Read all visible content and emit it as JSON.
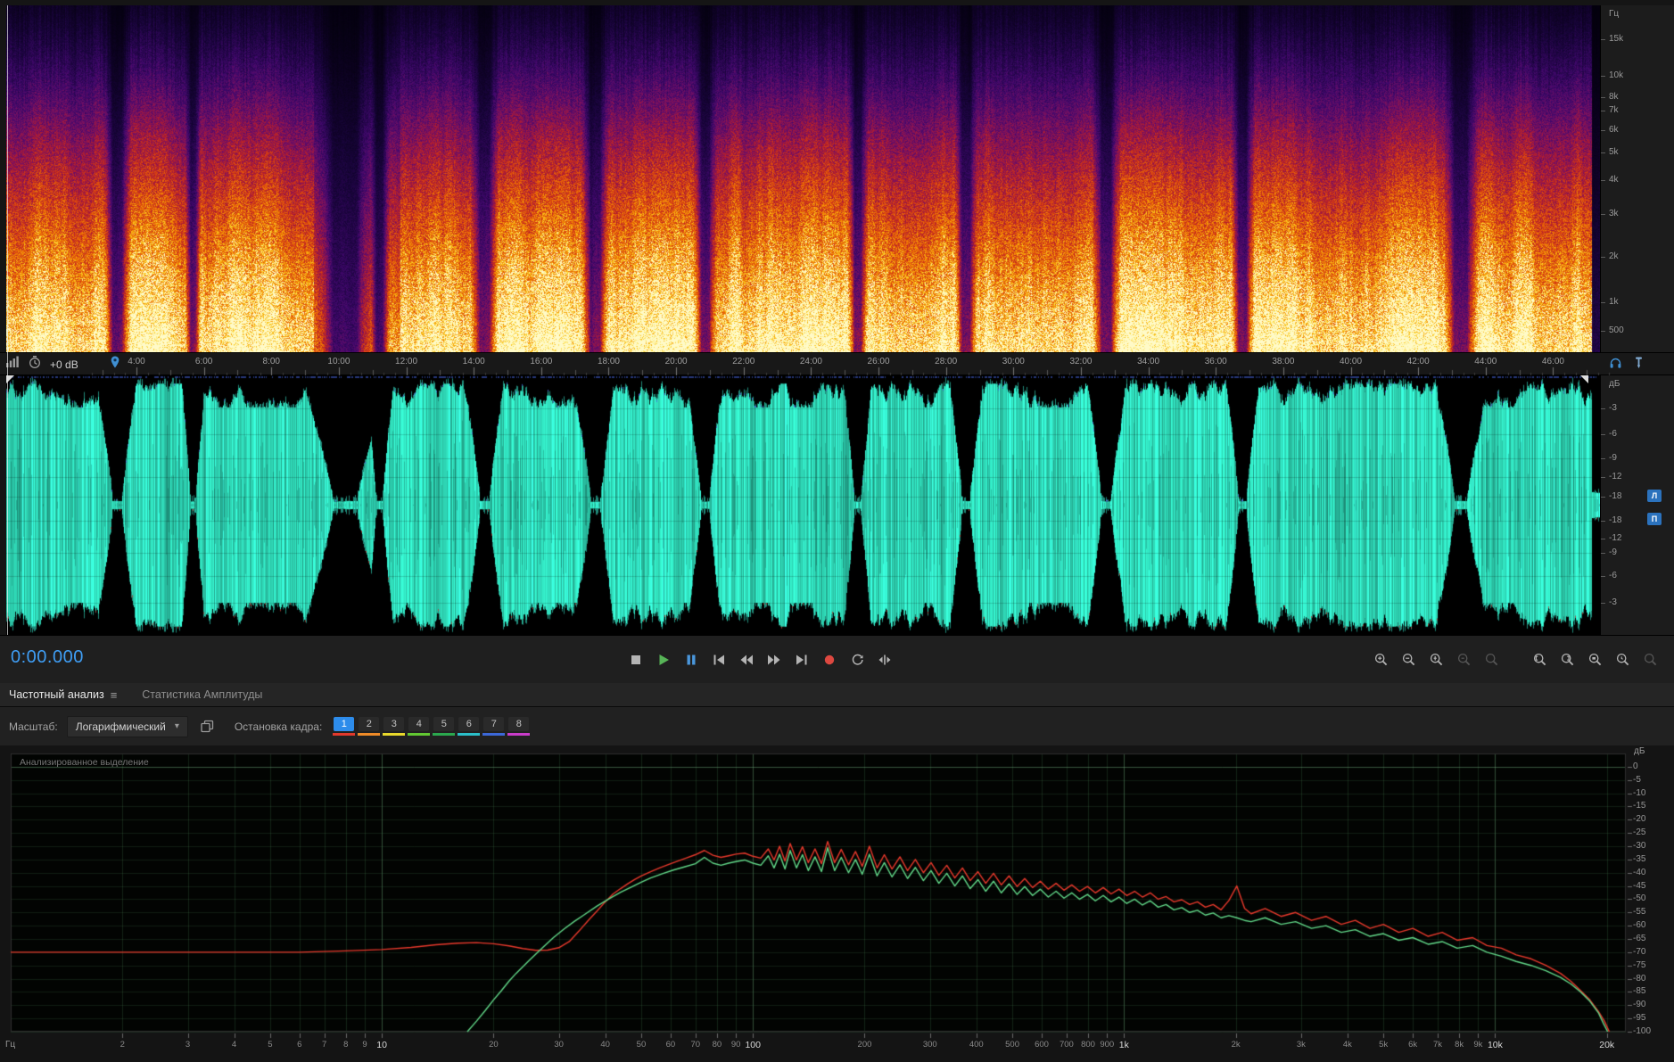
{
  "spectral_scale": {
    "unit": "Гц",
    "labels": [
      "15k",
      "10k",
      "8k",
      "7k",
      "6k",
      "5k",
      "4k",
      "3k",
      "2k",
      "1k",
      "500"
    ]
  },
  "timeline": {
    "gain_label": "+0 dB",
    "labels": [
      "4:00",
      "6:00",
      "8:00",
      "10:00",
      "12:00",
      "14:00",
      "16:00",
      "18:00",
      "20:00",
      "22:00",
      "24:00",
      "26:00",
      "28:00",
      "30:00",
      "32:00",
      "34:00",
      "36:00",
      "38:00",
      "40:00",
      "42:00",
      "44:00",
      "46:00"
    ]
  },
  "wave_scale": {
    "unit": "дБ",
    "labels": [
      "-3",
      "-6",
      "-9",
      "-12",
      "-18",
      "-18",
      "-12",
      "-9",
      "-6",
      "-3"
    ],
    "channels": [
      "Л",
      "П"
    ]
  },
  "transport": {
    "time": "0:00.000"
  },
  "tabs": [
    {
      "label": "Частотный анализ",
      "active": true
    },
    {
      "label": "Статистика Амплитуды",
      "active": false
    }
  ],
  "controls": {
    "scale_label": "Масштаб:",
    "scale_value": "Логарифмический",
    "hold_label": "Остановка кадра:",
    "hold_buttons": [
      {
        "label": "1",
        "color": "#e2392c",
        "active": true
      },
      {
        "label": "2",
        "color": "#ef8b28",
        "active": false
      },
      {
        "label": "3",
        "color": "#e8d82c",
        "active": false
      },
      {
        "label": "4",
        "color": "#62c832",
        "active": false
      },
      {
        "label": "5",
        "color": "#2ba84e",
        "active": false
      },
      {
        "label": "6",
        "color": "#2bbfc9",
        "active": false
      },
      {
        "label": "7",
        "color": "#3c68d8",
        "active": false
      },
      {
        "label": "8",
        "color": "#c93cc9",
        "active": false
      }
    ]
  },
  "analysis": {
    "overlay_label": "Анализированное выделение"
  },
  "chart_data": {
    "type": "line",
    "title": "",
    "x_unit": "Гц",
    "y_unit": "дБ",
    "x_scale": "log",
    "xlim": [
      1,
      22500
    ],
    "ylim": [
      -100,
      5
    ],
    "grid": true,
    "x_ticks": [
      2,
      3,
      4,
      5,
      6,
      7,
      8,
      9,
      10,
      20,
      30,
      40,
      50,
      60,
      70,
      80,
      90,
      100,
      200,
      300,
      400,
      500,
      600,
      700,
      800,
      900,
      1000,
      2000,
      3000,
      4000,
      5000,
      6000,
      7000,
      8000,
      9000,
      10000,
      20000
    ],
    "x_tick_labels": [
      "2",
      "3",
      "4",
      "5",
      "6",
      "7",
      "8",
      "9",
      "10",
      "20",
      "30",
      "40",
      "50",
      "60",
      "70",
      "80",
      "90",
      "100",
      "200",
      "300",
      "400",
      "500",
      "600",
      "700",
      "800",
      "900",
      "1k",
      "2k",
      "3k",
      "4k",
      "5k",
      "6k",
      "7k",
      "8k",
      "9k",
      "10k",
      "20k"
    ],
    "y_ticks": [
      0,
      -5,
      -10,
      -15,
      -20,
      -25,
      -30,
      -35,
      -40,
      -45,
      -50,
      -55,
      -60,
      -65,
      -70,
      -75,
      -80,
      -85,
      -90,
      -95,
      -100
    ],
    "y_tick_labels": [
      "0",
      "-5",
      "-10",
      "-15",
      "-20",
      "-25",
      "-30",
      "-35",
      "-40",
      "-45",
      "-50",
      "-55",
      "-60",
      "-65",
      "-70",
      "-75",
      "-80",
      "-85",
      "-90",
      "-95",
      "-100"
    ],
    "series": [
      {
        "name": "red-channel",
        "color": "#e8392c",
        "points": [
          [
            1,
            -70
          ],
          [
            2,
            -70
          ],
          [
            3,
            -70
          ],
          [
            4,
            -70
          ],
          [
            5,
            -70
          ],
          [
            6,
            -70
          ],
          [
            8,
            -69.5
          ],
          [
            10,
            -69
          ],
          [
            12,
            -68.2
          ],
          [
            14,
            -67.2
          ],
          [
            16,
            -66.6
          ],
          [
            18,
            -66.4
          ],
          [
            20,
            -66.8
          ],
          [
            22,
            -67.6
          ],
          [
            24,
            -68.6
          ],
          [
            26,
            -69.3
          ],
          [
            28,
            -69.2
          ],
          [
            30,
            -68.3
          ],
          [
            32,
            -66
          ],
          [
            34,
            -62
          ],
          [
            36,
            -58
          ],
          [
            38,
            -54.5
          ],
          [
            40,
            -51
          ],
          [
            42,
            -48
          ],
          [
            44,
            -46
          ],
          [
            46,
            -44.2
          ],
          [
            48,
            -42.6
          ],
          [
            50,
            -41.2
          ],
          [
            53,
            -39.6
          ],
          [
            56,
            -38.2
          ],
          [
            60,
            -36.6
          ],
          [
            63,
            -35.5
          ],
          [
            66,
            -34.5
          ],
          [
            70,
            -33.2
          ],
          [
            74,
            -31.6
          ],
          [
            78,
            -33.4
          ],
          [
            82,
            -34.2
          ],
          [
            86,
            -33.6
          ],
          [
            90,
            -33
          ],
          [
            95,
            -32.6
          ],
          [
            100,
            -33.8
          ],
          [
            105,
            -34.5
          ],
          [
            110,
            -31
          ],
          [
            114,
            -35.2
          ],
          [
            118,
            -30
          ],
          [
            122,
            -35.6
          ],
          [
            126,
            -29
          ],
          [
            131,
            -35.2
          ],
          [
            136,
            -30.2
          ],
          [
            141,
            -36.2
          ],
          [
            147,
            -31
          ],
          [
            153,
            -36.6
          ],
          [
            159,
            -28.2
          ],
          [
            166,
            -36.2
          ],
          [
            173,
            -31.2
          ],
          [
            181,
            -37
          ],
          [
            189,
            -32
          ],
          [
            197,
            -37.6
          ],
          [
            206,
            -30
          ],
          [
            216,
            -38.2
          ],
          [
            226,
            -33.2
          ],
          [
            237,
            -38.6
          ],
          [
            249,
            -34
          ],
          [
            261,
            -39.2
          ],
          [
            274,
            -35
          ],
          [
            288,
            -40
          ],
          [
            302,
            -36.2
          ],
          [
            317,
            -41
          ],
          [
            333,
            -37.2
          ],
          [
            350,
            -42
          ],
          [
            367,
            -38.2
          ],
          [
            385,
            -43
          ],
          [
            404,
            -39.6
          ],
          [
            424,
            -44
          ],
          [
            445,
            -40.2
          ],
          [
            467,
            -44.6
          ],
          [
            490,
            -41.2
          ],
          [
            515,
            -45.2
          ],
          [
            540,
            -42.2
          ],
          [
            567,
            -45.6
          ],
          [
            595,
            -43.2
          ],
          [
            625,
            -46.2
          ],
          [
            656,
            -44
          ],
          [
            689,
            -46.6
          ],
          [
            723,
            -44.6
          ],
          [
            759,
            -47
          ],
          [
            797,
            -45.2
          ],
          [
            837,
            -47.6
          ],
          [
            879,
            -45.6
          ],
          [
            923,
            -48
          ],
          [
            969,
            -46.2
          ],
          [
            1017,
            -48.6
          ],
          [
            1068,
            -47
          ],
          [
            1121,
            -49.2
          ],
          [
            1177,
            -47.6
          ],
          [
            1236,
            -50
          ],
          [
            1298,
            -49
          ],
          [
            1363,
            -51
          ],
          [
            1431,
            -50.2
          ],
          [
            1502,
            -52
          ],
          [
            1577,
            -51
          ],
          [
            1656,
            -53
          ],
          [
            1739,
            -52
          ],
          [
            1826,
            -54
          ],
          [
            1917,
            -50.5
          ],
          [
            2013,
            -45
          ],
          [
            2113,
            -53.5
          ],
          [
            2200,
            -55.5
          ],
          [
            2400,
            -53.5
          ],
          [
            2650,
            -56.5
          ],
          [
            2900,
            -55
          ],
          [
            3200,
            -58
          ],
          [
            3500,
            -56.5
          ],
          [
            3850,
            -59.5
          ],
          [
            4200,
            -58
          ],
          [
            4600,
            -61
          ],
          [
            5000,
            -59.5
          ],
          [
            5500,
            -62.5
          ],
          [
            6000,
            -61
          ],
          [
            6600,
            -64
          ],
          [
            7200,
            -62.5
          ],
          [
            7900,
            -65.5
          ],
          [
            8700,
            -64.5
          ],
          [
            9500,
            -67.5
          ],
          [
            10400,
            -68.5
          ],
          [
            11400,
            -71
          ],
          [
            12500,
            -72.5
          ],
          [
            13700,
            -75
          ],
          [
            15000,
            -78
          ],
          [
            16000,
            -81
          ],
          [
            17000,
            -84.5
          ],
          [
            18000,
            -88
          ],
          [
            19000,
            -92.5
          ],
          [
            19700,
            -96
          ],
          [
            20300,
            -100
          ]
        ]
      },
      {
        "name": "green-channel",
        "color": "#62d989",
        "points": [
          [
            17,
            -100
          ],
          [
            18,
            -96
          ],
          [
            19,
            -92
          ],
          [
            20,
            -88
          ],
          [
            21,
            -84.5
          ],
          [
            22,
            -81
          ],
          [
            23,
            -78
          ],
          [
            25,
            -73
          ],
          [
            27,
            -68.5
          ],
          [
            29,
            -64.5
          ],
          [
            31,
            -61.2
          ],
          [
            33,
            -58.4
          ],
          [
            35,
            -56
          ],
          [
            38,
            -52.6
          ],
          [
            41,
            -49.8
          ],
          [
            44,
            -47.4
          ],
          [
            47,
            -45.4
          ],
          [
            50,
            -43.6
          ],
          [
            53,
            -42
          ],
          [
            57,
            -40.4
          ],
          [
            61,
            -39
          ],
          [
            65,
            -37.9
          ],
          [
            70,
            -36.6
          ],
          [
            74,
            -34.2
          ],
          [
            78,
            -36.4
          ],
          [
            82,
            -37.2
          ],
          [
            86,
            -36.4
          ],
          [
            90,
            -35.8
          ],
          [
            95,
            -35.2
          ],
          [
            100,
            -36.4
          ],
          [
            105,
            -37.2
          ],
          [
            110,
            -33.6
          ],
          [
            114,
            -38.2
          ],
          [
            118,
            -33
          ],
          [
            122,
            -38.6
          ],
          [
            126,
            -31.6
          ],
          [
            131,
            -38.2
          ],
          [
            136,
            -33.2
          ],
          [
            141,
            -39.2
          ],
          [
            147,
            -34
          ],
          [
            153,
            -39.6
          ],
          [
            159,
            -30.6
          ],
          [
            166,
            -39.2
          ],
          [
            173,
            -34.2
          ],
          [
            181,
            -40
          ],
          [
            189,
            -35
          ],
          [
            197,
            -40.6
          ],
          [
            206,
            -33
          ],
          [
            216,
            -41.2
          ],
          [
            226,
            -36.2
          ],
          [
            237,
            -41.6
          ],
          [
            249,
            -37
          ],
          [
            261,
            -42.2
          ],
          [
            274,
            -38
          ],
          [
            288,
            -43
          ],
          [
            302,
            -39.2
          ],
          [
            317,
            -44
          ],
          [
            333,
            -40.2
          ],
          [
            350,
            -45
          ],
          [
            367,
            -41.2
          ],
          [
            385,
            -46
          ],
          [
            404,
            -42.6
          ],
          [
            424,
            -47
          ],
          [
            445,
            -43.2
          ],
          [
            467,
            -47.6
          ],
          [
            490,
            -44.2
          ],
          [
            515,
            -48.2
          ],
          [
            540,
            -45.2
          ],
          [
            567,
            -48.6
          ],
          [
            595,
            -46.2
          ],
          [
            625,
            -49.2
          ],
          [
            656,
            -47
          ],
          [
            689,
            -49.6
          ],
          [
            723,
            -47.6
          ],
          [
            759,
            -50
          ],
          [
            797,
            -48.2
          ],
          [
            837,
            -50.6
          ],
          [
            879,
            -48.6
          ],
          [
            923,
            -51
          ],
          [
            969,
            -49.2
          ],
          [
            1017,
            -51.6
          ],
          [
            1068,
            -50
          ],
          [
            1121,
            -52.2
          ],
          [
            1177,
            -50.6
          ],
          [
            1236,
            -53
          ],
          [
            1298,
            -52
          ],
          [
            1363,
            -54
          ],
          [
            1431,
            -53.2
          ],
          [
            1502,
            -55
          ],
          [
            1577,
            -54.2
          ],
          [
            1656,
            -56
          ],
          [
            1739,
            -55.2
          ],
          [
            1826,
            -57
          ],
          [
            1917,
            -56.2
          ],
          [
            2013,
            -57
          ],
          [
            2113,
            -58
          ],
          [
            2200,
            -58.5
          ],
          [
            2400,
            -57
          ],
          [
            2650,
            -59.5
          ],
          [
            2900,
            -58.5
          ],
          [
            3200,
            -61
          ],
          [
            3500,
            -60
          ],
          [
            3850,
            -62.5
          ],
          [
            4200,
            -61.5
          ],
          [
            4600,
            -64
          ],
          [
            5000,
            -63
          ],
          [
            5500,
            -65.5
          ],
          [
            6000,
            -64.5
          ],
          [
            6600,
            -67
          ],
          [
            7200,
            -66
          ],
          [
            7900,
            -68.5
          ],
          [
            8700,
            -67.5
          ],
          [
            9500,
            -70
          ],
          [
            10400,
            -71.5
          ],
          [
            11400,
            -73.5
          ],
          [
            12500,
            -75
          ],
          [
            13700,
            -77
          ],
          [
            15000,
            -79.5
          ],
          [
            16000,
            -82
          ],
          [
            17000,
            -85
          ],
          [
            18000,
            -88.5
          ],
          [
            19000,
            -93
          ],
          [
            19600,
            -97
          ],
          [
            20100,
            -100
          ]
        ]
      }
    ]
  }
}
